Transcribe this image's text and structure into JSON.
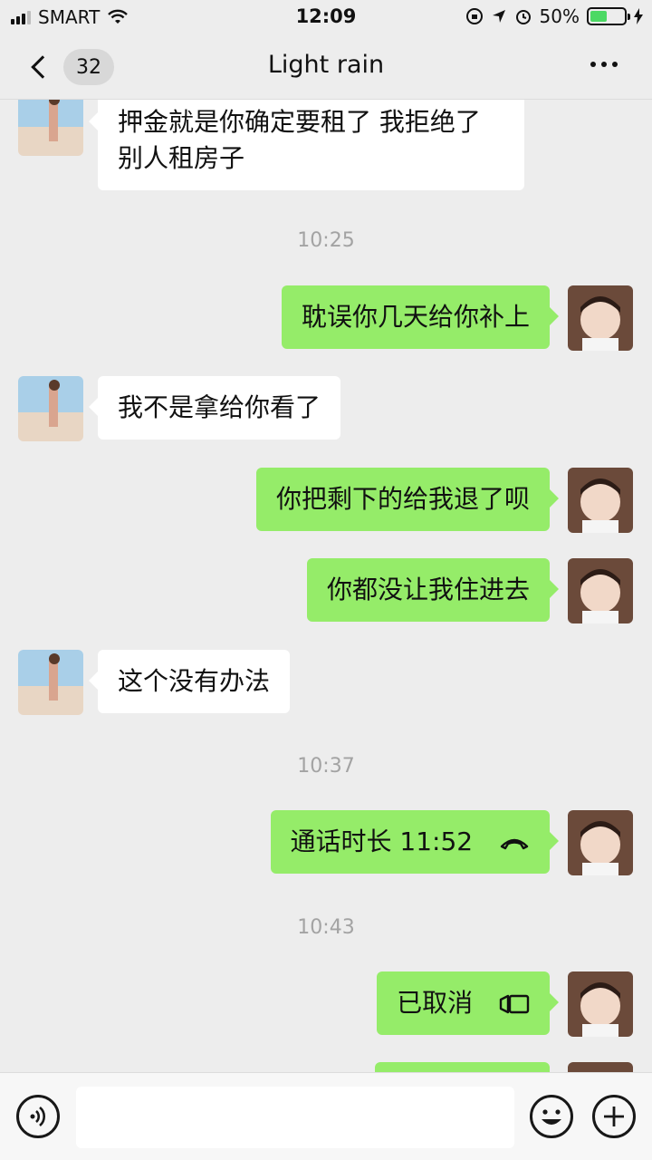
{
  "status_bar": {
    "carrier": "SMART",
    "time": "12:09",
    "battery": "50%",
    "battery_level": 0.5
  },
  "nav": {
    "unread_count": "32",
    "title": "Light rain"
  },
  "messages": [
    {
      "side": "in",
      "text_line1": "押金就是你确定要租了 我拒绝了",
      "text_line2": "别人租房子"
    },
    {
      "type": "timestamp",
      "text": "10:25"
    },
    {
      "side": "out",
      "text": "耽误你几天给你补上"
    },
    {
      "side": "in",
      "text": "我不是拿给你看了"
    },
    {
      "side": "out",
      "text": "你把剩下的给我退了呗"
    },
    {
      "side": "out",
      "text": "你都没让我住进去"
    },
    {
      "side": "in",
      "text": "这个没有办法"
    },
    {
      "type": "timestamp",
      "text": "10:37"
    },
    {
      "side": "out",
      "text": "通话时长 11:52",
      "icon": "phone-hangup-icon"
    },
    {
      "type": "timestamp",
      "text": "10:43"
    },
    {
      "side": "out",
      "text": "已取消",
      "icon": "video-call-icon"
    }
  ],
  "icons": {
    "back": "chevron-left-icon",
    "more": "more-dots-icon",
    "voice": "voice-input-icon",
    "emoji": "emoji-icon",
    "plus": "plus-icon"
  },
  "colors": {
    "background": "#ededed",
    "outgoing_bubble": "#95ec69",
    "incoming_bubble": "#ffffff",
    "timestamp": "#a3a3a3"
  }
}
